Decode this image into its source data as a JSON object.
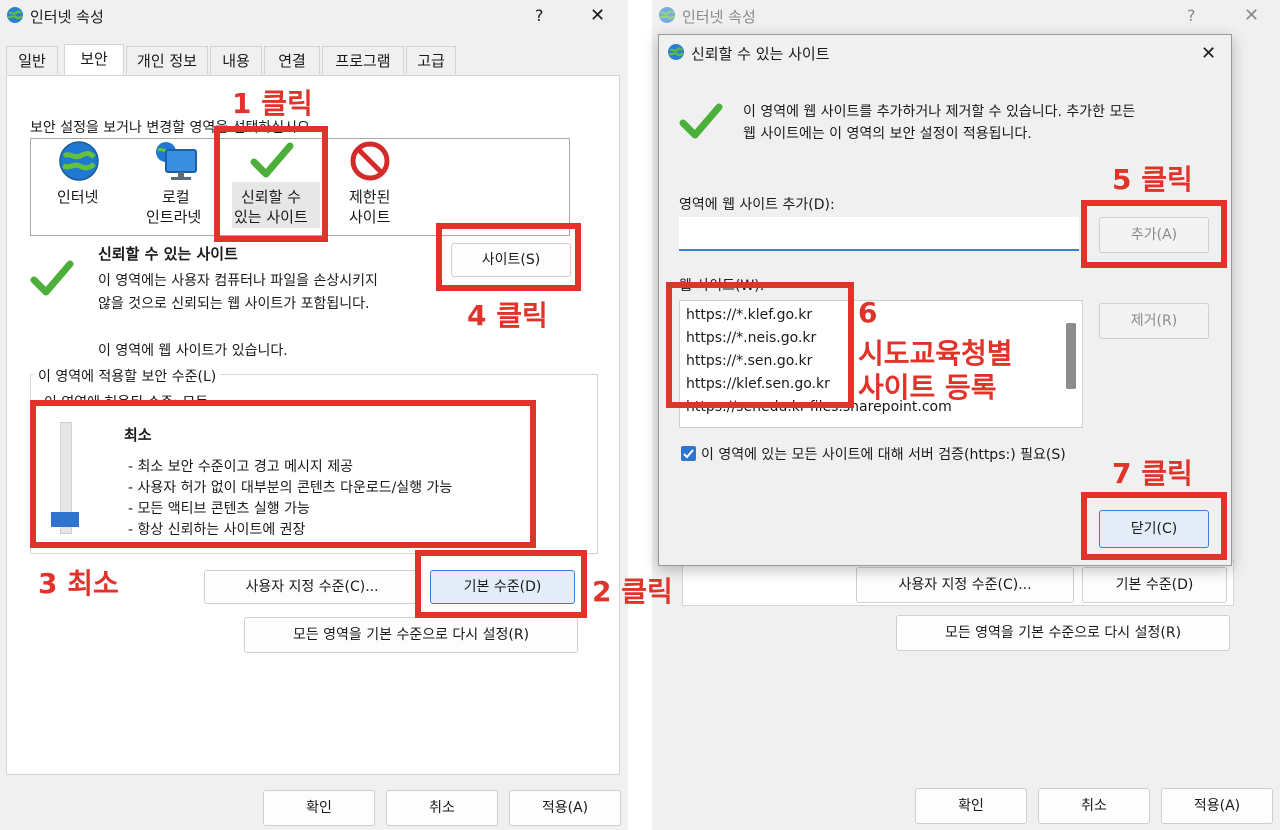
{
  "left": {
    "title": "인터넷 속성",
    "help": "?",
    "close": "✕",
    "tabs": [
      "일반",
      "보안",
      "개인 정보",
      "내용",
      "연결",
      "프로그램",
      "고급"
    ],
    "select_zone_text": "보안 설정을 보거나 변경할 영역을 선택하십시오.",
    "zones": [
      {
        "line1": "인터넷",
        "line2": ""
      },
      {
        "line1": "로컬",
        "line2": "인트라넷"
      },
      {
        "line1": "신뢰할 수",
        "line2": "있는 사이트"
      },
      {
        "line1": "제한된",
        "line2": "사이트"
      }
    ],
    "zone_title": "신뢰할 수 있는 사이트",
    "zone_desc1": "이 영역에는 사용자 컴퓨터나 파일을 손상시키지",
    "zone_desc2": "않을 것으로 신뢰되는 웹 사이트가 포함됩니다.",
    "zone_has_sites": "이 영역에 웹 사이트가 있습니다.",
    "sites_button": "사이트(S)",
    "security_level_group": "이 영역에 적용할 보안 수준(L)",
    "allowed_levels": "이 영역에 허용된 수준: 모든",
    "level_name": "최소",
    "level_bullets": [
      "- 최소 보안 수준이고 경고 메시지 제공",
      "- 사용자 허가 없이 대부분의 콘텐츠 다운로드/실행 가능",
      "- 모든 액티브 콘텐츠 실행 가능",
      "- 항상 신뢰하는 사이트에 권장"
    ],
    "custom_level_button": "사용자 지정 수준(C)...",
    "default_level_button": "기본 수준(D)",
    "reset_all_button": "모든 영역을 기본 수준으로 다시 설정(R)",
    "ok_button": "확인",
    "cancel_button": "취소",
    "apply_button": "적용(A)"
  },
  "right": {
    "bg_title": "인터넷 속성",
    "bg_help": "?",
    "bg_close": "✕",
    "custom_level_button": "사용자 지정 수준(C)...",
    "default_level_button": "기본 수준(D)",
    "reset_all_button": "모든 영역을 기본 수준으로 다시 설정(R)",
    "ok_button": "확인",
    "cancel_button": "취소",
    "apply_button": "적용(A)"
  },
  "dialog": {
    "title": "신뢰할 수 있는 사이트",
    "close": "✕",
    "desc1": "이 영역에 웹 사이트를 추가하거나 제거할 수 있습니다. 추가한 모든",
    "desc2": "웹 사이트에는 이 영역의 보안 설정이 적용됩니다.",
    "add_label": "영역에 웹 사이트 추가(D):",
    "add_input_value": "",
    "add_button": "추가(A)",
    "websites_label": "웹 사이트(W):",
    "websites": [
      "https://*.klef.go.kr",
      "https://*.neis.go.kr",
      "https://*.sen.go.kr",
      "https://klef.sen.go.kr",
      "https://senedu.kr-files.sharepoint.com"
    ],
    "remove_button": "제거(R)",
    "https_checkbox_label": "이 영역에 있는 모든 사이트에 대해 서버 검증(https:) 필요(S)",
    "https_checked": true,
    "close_button": "닫기(C)"
  },
  "annotations": {
    "step1": "1 클릭",
    "step2": "2 클릭",
    "step3": "3 최소",
    "step4": "4 클릭",
    "step5": "5 클릭",
    "step6_num": "6",
    "step6_line1": "시도교육청별",
    "step6_line2": "사이트 등록",
    "step7": "7 클릭"
  },
  "colors": {
    "annotation_red": "#e0342b",
    "accent_blue": "#3c7fd8",
    "check_green": "#4caf3a"
  }
}
